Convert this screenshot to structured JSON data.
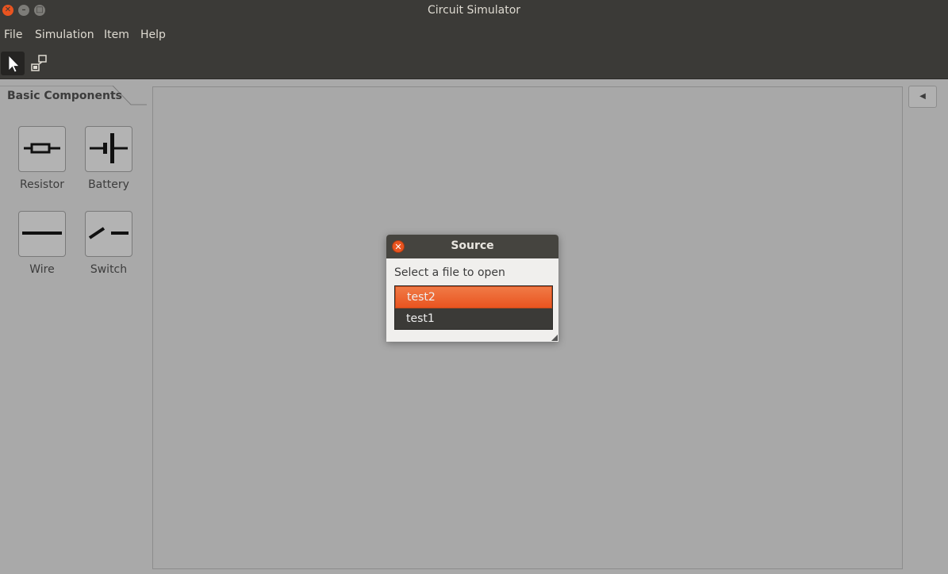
{
  "window": {
    "title": "Circuit Simulator"
  },
  "menu": {
    "items": [
      "File",
      "Simulation",
      "Item",
      "Help"
    ]
  },
  "toolbar": {
    "tools": [
      {
        "name": "pointer-select",
        "icon": "cursor-arrow-icon",
        "active": true
      },
      {
        "name": "link-tool",
        "icon": "link-nodes-icon",
        "active": false
      }
    ]
  },
  "dock": {
    "tab_label": "Basic Components",
    "components": [
      {
        "label": "Resistor",
        "icon": "resistor-icon"
      },
      {
        "label": "Battery",
        "icon": "battery-icon"
      },
      {
        "label": "Wire",
        "icon": "wire-icon"
      },
      {
        "label": "Switch",
        "icon": "switch-icon"
      }
    ]
  },
  "dialog": {
    "title": "Source",
    "prompt": "Select a file to open",
    "files": [
      "test2",
      "test1"
    ],
    "selected_file": "test2"
  },
  "colors": {
    "accent": "#e95420",
    "titlebar": "#3b3a37",
    "canvas": "#a8a8a8"
  }
}
